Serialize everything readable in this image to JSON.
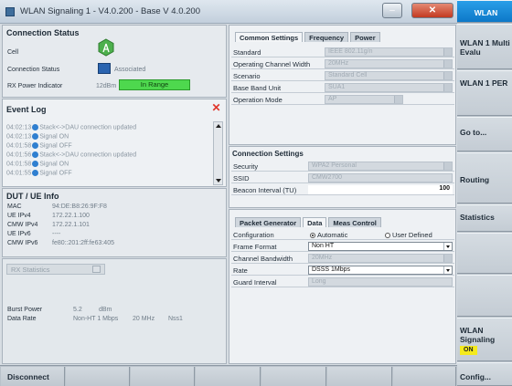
{
  "window": {
    "title": "WLAN Signaling 1 - V4.0.200 - Base V 4.0.200"
  },
  "connection_status": {
    "title": "Connection Status",
    "cell_label": "Cell",
    "conn_label": "Connection Status",
    "conn_value": "Associated",
    "rx_label": "RX Power Indicator",
    "rx_value": "12dBm",
    "rx_status": "In Range"
  },
  "event_log": {
    "title": "Event Log",
    "entries": [
      {
        "time": "04:02:13",
        "text": "Stack<->DAU connection updated"
      },
      {
        "time": "04:02:13",
        "text": "Signal ON"
      },
      {
        "time": "04:01:58",
        "text": "Signal OFF"
      },
      {
        "time": "04:01:56",
        "text": "Stack<->DAU connection updated"
      },
      {
        "time": "04:01:58",
        "text": "Signal ON"
      },
      {
        "time": "04:01:55",
        "text": "Signal OFF"
      }
    ]
  },
  "dut_info": {
    "title": "DUT / UE Info",
    "rows": [
      {
        "label": "MAC",
        "value": "94:DE:B8:26:9F:F8"
      },
      {
        "label": "UE IPv4",
        "value": "172.22.1.100"
      },
      {
        "label": "CMW IPv4",
        "value": "172.22.1.101"
      },
      {
        "label": "UE IPv6",
        "value": "----"
      },
      {
        "label": "CMW IPv6",
        "value": "fe80::201:2ff:fe63:405"
      }
    ]
  },
  "rx_stats": {
    "title": "RX Statistics",
    "burst_label": "Burst Power",
    "burst_value": "5.2",
    "burst_unit": "dBm",
    "rate_label": "Data Rate",
    "rate_value": "Non-HT 1 Mbps",
    "rate_bw": "20 MHz",
    "rate_nss": "Nss1"
  },
  "common_settings": {
    "tabs": [
      "Common Settings",
      "Frequency",
      "Power"
    ],
    "rows": [
      {
        "label": "Standard",
        "value": "IEEE 802.11g/n"
      },
      {
        "label": "Operating Channel Width",
        "value": "20MHz"
      },
      {
        "label": "Scenario",
        "value": "Standard Cell"
      },
      {
        "label": "Base Band Unit",
        "value": "SUA1"
      },
      {
        "label": "Operation Mode",
        "value": "AP"
      }
    ]
  },
  "connection_settings": {
    "title": "Connection Settings",
    "rows": [
      {
        "label": "Security",
        "value": "WPA2 Personal"
      },
      {
        "label": "SSID",
        "value": "CMW2700"
      },
      {
        "label": "Beacon Interval (TU)",
        "value": "100"
      }
    ]
  },
  "packet_settings": {
    "tabs": [
      "Packet Generator",
      "Data",
      "Meas Control"
    ],
    "config_label": "Configuration",
    "config_opt1": "Automatic",
    "config_opt2": "User Defined",
    "rows": [
      {
        "label": "Frame Format",
        "value": "Non HT"
      },
      {
        "label": "Channel Bandwidth",
        "value": "20MHz"
      },
      {
        "label": "Rate",
        "value": "DSSS 1Mbps"
      },
      {
        "label": "Guard Interval",
        "value": "Long"
      }
    ]
  },
  "softkeys": {
    "top": "WLAN",
    "k1": "WLAN 1 Multi Evalu",
    "k2": "WLAN 1 PER",
    "k3": "Go to...",
    "k4": "Routing",
    "k5": "Statistics",
    "k6": "WLAN Signaling",
    "k6_state": "ON",
    "k7": "Config..."
  },
  "bottom": {
    "disconnect": "Disconnect"
  }
}
